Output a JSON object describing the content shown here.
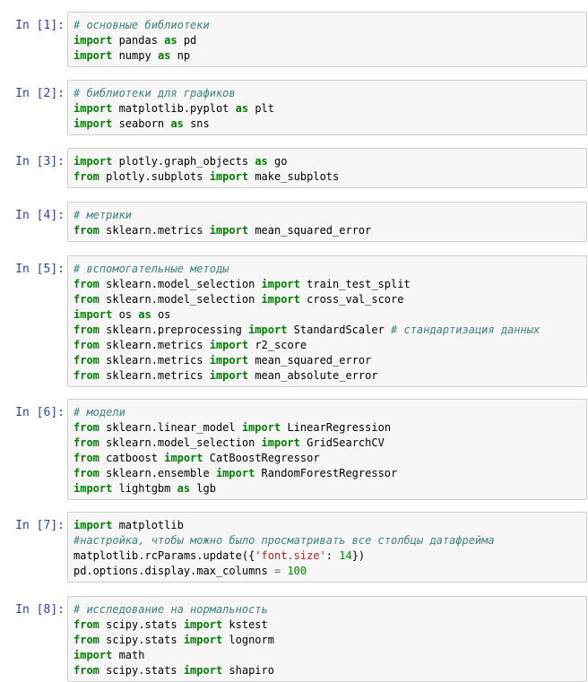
{
  "notebook": {
    "cells": [
      {
        "prompt": "In [1]:",
        "lines": [
          [
            [
              "cm",
              "# основные библиотеки"
            ]
          ],
          [
            [
              "kw",
              "import"
            ],
            [
              "tx",
              " pandas "
            ],
            [
              "kw",
              "as"
            ],
            [
              "tx",
              " pd"
            ]
          ],
          [
            [
              "kw",
              "import"
            ],
            [
              "tx",
              " numpy "
            ],
            [
              "kw",
              "as"
            ],
            [
              "tx",
              " np"
            ]
          ]
        ]
      },
      {
        "prompt": "In [2]:",
        "lines": [
          [
            [
              "cm",
              "# библиотеки для графиков"
            ]
          ],
          [
            [
              "kw",
              "import"
            ],
            [
              "tx",
              " matplotlib.pyplot "
            ],
            [
              "kw",
              "as"
            ],
            [
              "tx",
              " plt"
            ]
          ],
          [
            [
              "kw",
              "import"
            ],
            [
              "tx",
              " seaborn "
            ],
            [
              "kw",
              "as"
            ],
            [
              "tx",
              " sns"
            ]
          ]
        ]
      },
      {
        "prompt": "In [3]:",
        "lines": [
          [
            [
              "kw",
              "import"
            ],
            [
              "tx",
              " plotly.graph_objects "
            ],
            [
              "kw",
              "as"
            ],
            [
              "tx",
              " go"
            ]
          ],
          [
            [
              "kw",
              "from"
            ],
            [
              "tx",
              " plotly.subplots "
            ],
            [
              "kw",
              "import"
            ],
            [
              "tx",
              " make_subplots"
            ]
          ]
        ]
      },
      {
        "prompt": "In [4]:",
        "lines": [
          [
            [
              "cm",
              "# метрики"
            ]
          ],
          [
            [
              "kw",
              "from"
            ],
            [
              "tx",
              " sklearn.metrics "
            ],
            [
              "kw",
              "import"
            ],
            [
              "tx",
              " mean_squared_error"
            ]
          ]
        ]
      },
      {
        "prompt": "In [5]:",
        "lines": [
          [
            [
              "cm",
              "# вспомогательные методы"
            ]
          ],
          [
            [
              "kw",
              "from"
            ],
            [
              "tx",
              " sklearn.model_selection "
            ],
            [
              "kw",
              "import"
            ],
            [
              "tx",
              " train_test_split"
            ]
          ],
          [
            [
              "kw",
              "from"
            ],
            [
              "tx",
              " sklearn.model_selection "
            ],
            [
              "kw",
              "import"
            ],
            [
              "tx",
              " cross_val_score"
            ]
          ],
          [
            [
              "kw",
              "import"
            ],
            [
              "tx",
              " os "
            ],
            [
              "kw",
              "as"
            ],
            [
              "tx",
              " os"
            ]
          ],
          [
            [
              "kw",
              "from"
            ],
            [
              "tx",
              " sklearn.preprocessing "
            ],
            [
              "kw",
              "import"
            ],
            [
              "tx",
              " StandardScaler "
            ],
            [
              "cm",
              "# стандартизация данных"
            ]
          ],
          [
            [
              "kw",
              "from"
            ],
            [
              "tx",
              " sklearn.metrics "
            ],
            [
              "kw",
              "import"
            ],
            [
              "tx",
              " r2_score"
            ]
          ],
          [
            [
              "kw",
              "from"
            ],
            [
              "tx",
              " sklearn.metrics "
            ],
            [
              "kw",
              "import"
            ],
            [
              "tx",
              " mean_squared_error"
            ]
          ],
          [
            [
              "kw",
              "from"
            ],
            [
              "tx",
              " sklearn.metrics "
            ],
            [
              "kw",
              "import"
            ],
            [
              "tx",
              " mean_absolute_error"
            ]
          ]
        ]
      },
      {
        "prompt": "In [6]:",
        "lines": [
          [
            [
              "cm",
              "# модели"
            ]
          ],
          [
            [
              "kw",
              "from"
            ],
            [
              "tx",
              " sklearn.linear_model "
            ],
            [
              "kw",
              "import"
            ],
            [
              "tx",
              " LinearRegression"
            ]
          ],
          [
            [
              "kw",
              "from"
            ],
            [
              "tx",
              " sklearn.model_selection "
            ],
            [
              "kw",
              "import"
            ],
            [
              "tx",
              " GridSearchCV"
            ]
          ],
          [
            [
              "kw",
              "from"
            ],
            [
              "tx",
              " catboost "
            ],
            [
              "kw",
              "import"
            ],
            [
              "tx",
              " CatBoostRegressor"
            ]
          ],
          [
            [
              "kw",
              "from"
            ],
            [
              "tx",
              " sklearn.ensemble "
            ],
            [
              "kw",
              "import"
            ],
            [
              "tx",
              " RandomForestRegressor"
            ]
          ],
          [
            [
              "kw",
              "import"
            ],
            [
              "tx",
              " lightgbm "
            ],
            [
              "kw",
              "as"
            ],
            [
              "tx",
              " lgb"
            ]
          ]
        ]
      },
      {
        "prompt": "In [7]:",
        "lines": [
          [
            [
              "kw",
              "import"
            ],
            [
              "tx",
              " matplotlib"
            ]
          ],
          [
            [
              "cm",
              "#настройка, чтобы можно было просматривать все столбцы датафрейма"
            ]
          ],
          [
            [
              "tx",
              "matplotlib.rcParams.update({"
            ],
            [
              "st",
              "'font.size'"
            ],
            [
              "tx",
              ": "
            ],
            [
              "nm",
              "14"
            ],
            [
              "tx",
              "})"
            ]
          ],
          [
            [
              "tx",
              "pd.options.display.max_columns "
            ],
            [
              "op",
              "="
            ],
            [
              "tx",
              " "
            ],
            [
              "nm",
              "100"
            ]
          ]
        ]
      },
      {
        "prompt": "In [8]:",
        "lines": [
          [
            [
              "cm",
              "# исследование на нормальность"
            ]
          ],
          [
            [
              "kw",
              "from"
            ],
            [
              "tx",
              " scipy.stats "
            ],
            [
              "kw",
              "import"
            ],
            [
              "tx",
              " kstest"
            ]
          ],
          [
            [
              "kw",
              "from"
            ],
            [
              "tx",
              " scipy.stats "
            ],
            [
              "kw",
              "import"
            ],
            [
              "tx",
              " lognorm"
            ]
          ],
          [
            [
              "kw",
              "import"
            ],
            [
              "tx",
              " math"
            ]
          ],
          [
            [
              "kw",
              "from"
            ],
            [
              "tx",
              " scipy.stats "
            ],
            [
              "kw",
              "import"
            ],
            [
              "tx",
              " shapiro"
            ]
          ]
        ]
      }
    ]
  }
}
